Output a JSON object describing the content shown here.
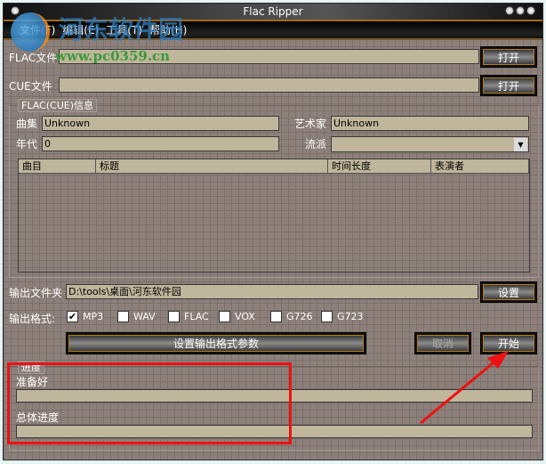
{
  "window": {
    "title": "Flac Ripper"
  },
  "watermark": {
    "logo_text": "河东软件园",
    "url": "www.pc0359.cn"
  },
  "menu": [
    "文件(F)",
    "编辑(E)",
    "工具(T)",
    "帮助(H)"
  ],
  "flac": {
    "label": "FLAC文件",
    "value": "",
    "button": "打开"
  },
  "cue": {
    "label": "CUE文件",
    "value": "",
    "button": "打开"
  },
  "info": {
    "legend": "FLAC(CUE)信息",
    "album_label": "曲集",
    "album": "Unknown",
    "artist_label": "艺术家",
    "artist": "Unknown",
    "year_label": "年代",
    "year": "0",
    "genre_label": "流派",
    "genre": "",
    "columns": [
      "曲目",
      "标题",
      "时间长度",
      "表演者"
    ]
  },
  "output": {
    "folder_label": "输出文件夹",
    "folder": "D:\\tools\\桌面\\河东软件园",
    "set_button": "设置",
    "format_label": "输出格式:",
    "formats": [
      {
        "label": "MP3",
        "checked": true
      },
      {
        "label": "WAV",
        "checked": false
      },
      {
        "label": "FLAC",
        "checked": false
      },
      {
        "label": "VOX",
        "checked": false
      },
      {
        "label": "G726",
        "checked": false
      },
      {
        "label": "G723",
        "checked": false
      }
    ],
    "params_button": "设置输出格式参数",
    "cancel_button": "取消",
    "start_button": "开始"
  },
  "progress": {
    "legend": "进度",
    "status": "准备好",
    "current": 0,
    "overall_label": "总体进度",
    "overall": 0
  },
  "annotation": {
    "color": "#f01010"
  }
}
